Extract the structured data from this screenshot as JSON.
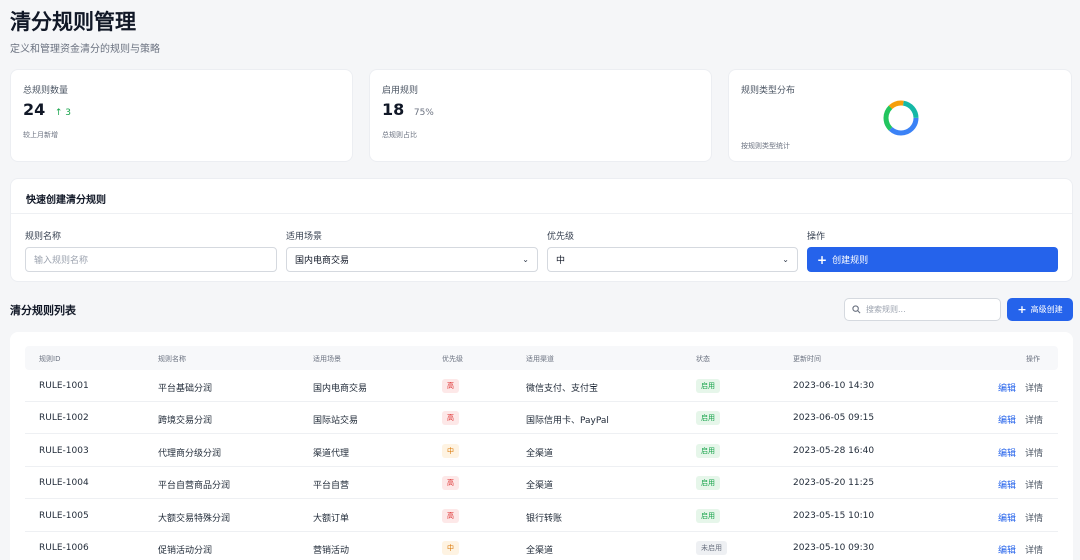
{
  "header": {
    "title": "清分规则管理",
    "subtitle": "定义和管理资金清分的规则与策略"
  },
  "stats": {
    "total": {
      "label": "总规则数量",
      "value": "24",
      "delta": "3",
      "note": "较上月新增"
    },
    "enabled": {
      "label": "启用规则",
      "value": "18",
      "percent": "75%",
      "note": "总规则占比"
    },
    "types": {
      "label": "规则类型分布",
      "note": "按规则类型统计"
    }
  },
  "quick_create": {
    "title": "快速创建清分规则",
    "name_label": "规则名称",
    "name_placeholder": "输入规则名称",
    "scene_label": "适用场景",
    "scene_value": "国内电商交易",
    "priority_label": "优先级",
    "priority_value": "中",
    "action_label": "操作",
    "create_button": "创建规则"
  },
  "list": {
    "title": "清分规则列表",
    "search_placeholder": "搜索规则...",
    "advanced_button": "高级创建",
    "columns": [
      "规则ID",
      "规则名称",
      "适用场景",
      "优先级",
      "适用渠道",
      "状态",
      "更新时间",
      "操作"
    ],
    "edit_label": "编辑",
    "detail_label": "详情",
    "rows": [
      {
        "id": "RULE-1001",
        "name": "平台基础分润",
        "scene": "国内电商交易",
        "priority": "高",
        "priority_level": "high",
        "channel": "微信支付、支付宝",
        "status": "启用",
        "status_state": "on",
        "updated": "2023-06-10 14:30"
      },
      {
        "id": "RULE-1002",
        "name": "跨境交易分润",
        "scene": "国际站交易",
        "priority": "高",
        "priority_level": "high",
        "channel": "国际信用卡、PayPal",
        "status": "启用",
        "status_state": "on",
        "updated": "2023-06-05 09:15"
      },
      {
        "id": "RULE-1003",
        "name": "代理商分级分润",
        "scene": "渠道代理",
        "priority": "中",
        "priority_level": "mid",
        "channel": "全渠道",
        "status": "启用",
        "status_state": "on",
        "updated": "2023-05-28 16:40"
      },
      {
        "id": "RULE-1004",
        "name": "平台自营商品分润",
        "scene": "平台自营",
        "priority": "高",
        "priority_level": "high",
        "channel": "全渠道",
        "status": "启用",
        "status_state": "on",
        "updated": "2023-05-20 11:25"
      },
      {
        "id": "RULE-1005",
        "name": "大额交易特殊分润",
        "scene": "大额订单",
        "priority": "高",
        "priority_level": "high",
        "channel": "银行转账",
        "status": "启用",
        "status_state": "on",
        "updated": "2023-05-15 10:10"
      },
      {
        "id": "RULE-1006",
        "name": "促销活动分润",
        "scene": "营销活动",
        "priority": "中",
        "priority_level": "mid",
        "channel": "全渠道",
        "status": "未启用",
        "status_state": "off",
        "updated": "2023-05-10 09:30"
      }
    ]
  },
  "colors": {
    "primary": "#2563eb",
    "success": "#16a34a",
    "danger": "#dc2626",
    "warning": "#d97706",
    "donut": [
      "#3b82f6",
      "#22c55e",
      "#f59e0b",
      "#14b8a6"
    ]
  },
  "icons": {
    "delta": "arrow-up-icon",
    "create": "plus-icon",
    "search": "search-icon",
    "select": "chevron-down-icon"
  }
}
